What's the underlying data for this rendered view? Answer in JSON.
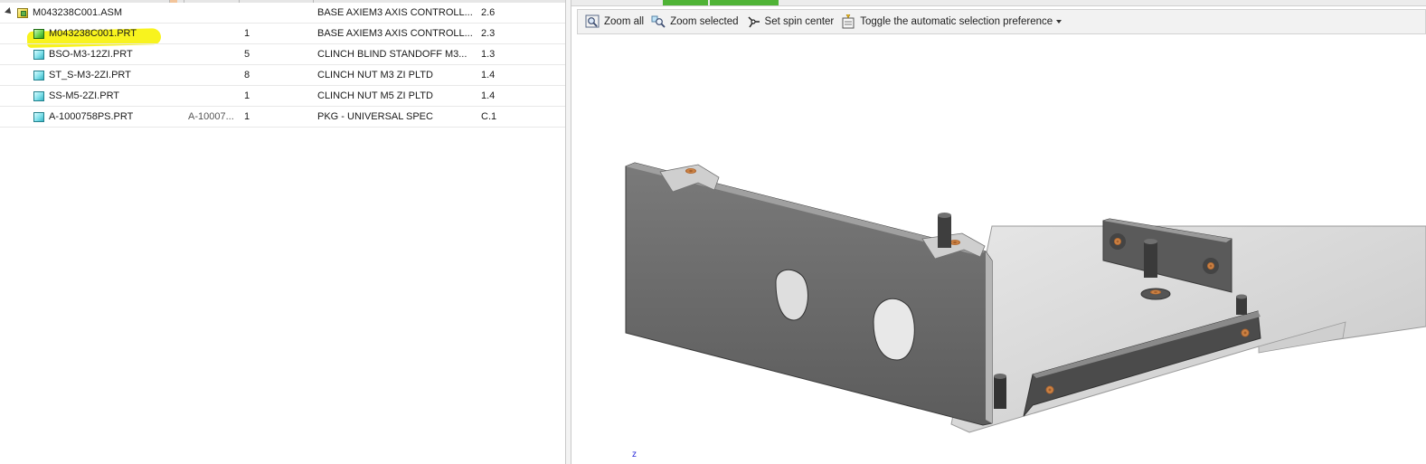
{
  "tree": {
    "rows": [
      {
        "name": "M043238C001.ASM",
        "qty": "",
        "ref": "",
        "description": "BASE AXIEM3 AXIS CONTROLL...",
        "version": "2.6",
        "icon": "assembly-icon"
      },
      {
        "name": "M043238C001.PRT",
        "qty": "1",
        "ref": "",
        "description": "BASE AXIEM3 AXIS CONTROLL...",
        "version": "2.3",
        "icon": "part-icon-selected"
      },
      {
        "name": "BSO-M3-12ZI.PRT",
        "qty": "5",
        "ref": "",
        "description": "CLINCH BLIND STANDOFF M3...",
        "version": "1.3",
        "icon": "part-icon"
      },
      {
        "name": "ST_S-M3-2ZI.PRT",
        "qty": "8",
        "ref": "",
        "description": "CLINCH NUT M3 ZI PLTD",
        "version": "1.4",
        "icon": "part-icon"
      },
      {
        "name": "SS-M5-2ZI.PRT",
        "qty": "1",
        "ref": "",
        "description": "CLINCH NUT M5 ZI PLTD",
        "version": "1.4",
        "icon": "part-icon"
      },
      {
        "name": "A-1000758PS.PRT",
        "qty": "1",
        "ref": "A-10007...",
        "description": "PKG - UNIVERSAL SPEC",
        "version": "C.1",
        "icon": "part-icon"
      }
    ],
    "highlighted_row": 1
  },
  "toolbar": {
    "zoom_all": "Zoom all",
    "zoom_selected": "Zoom selected",
    "set_spin_center": "Set spin center",
    "toggle_selection": "Toggle the automatic selection preference"
  },
  "viewer": {
    "axis_label": "z"
  },
  "colors": {
    "highlight": "#f8f31e",
    "tab_green": "#4fb336",
    "sheet_metal_dark": "#6e6e6e",
    "sheet_metal_light": "#d9d9d9",
    "copper_insert": "#c4773a"
  }
}
